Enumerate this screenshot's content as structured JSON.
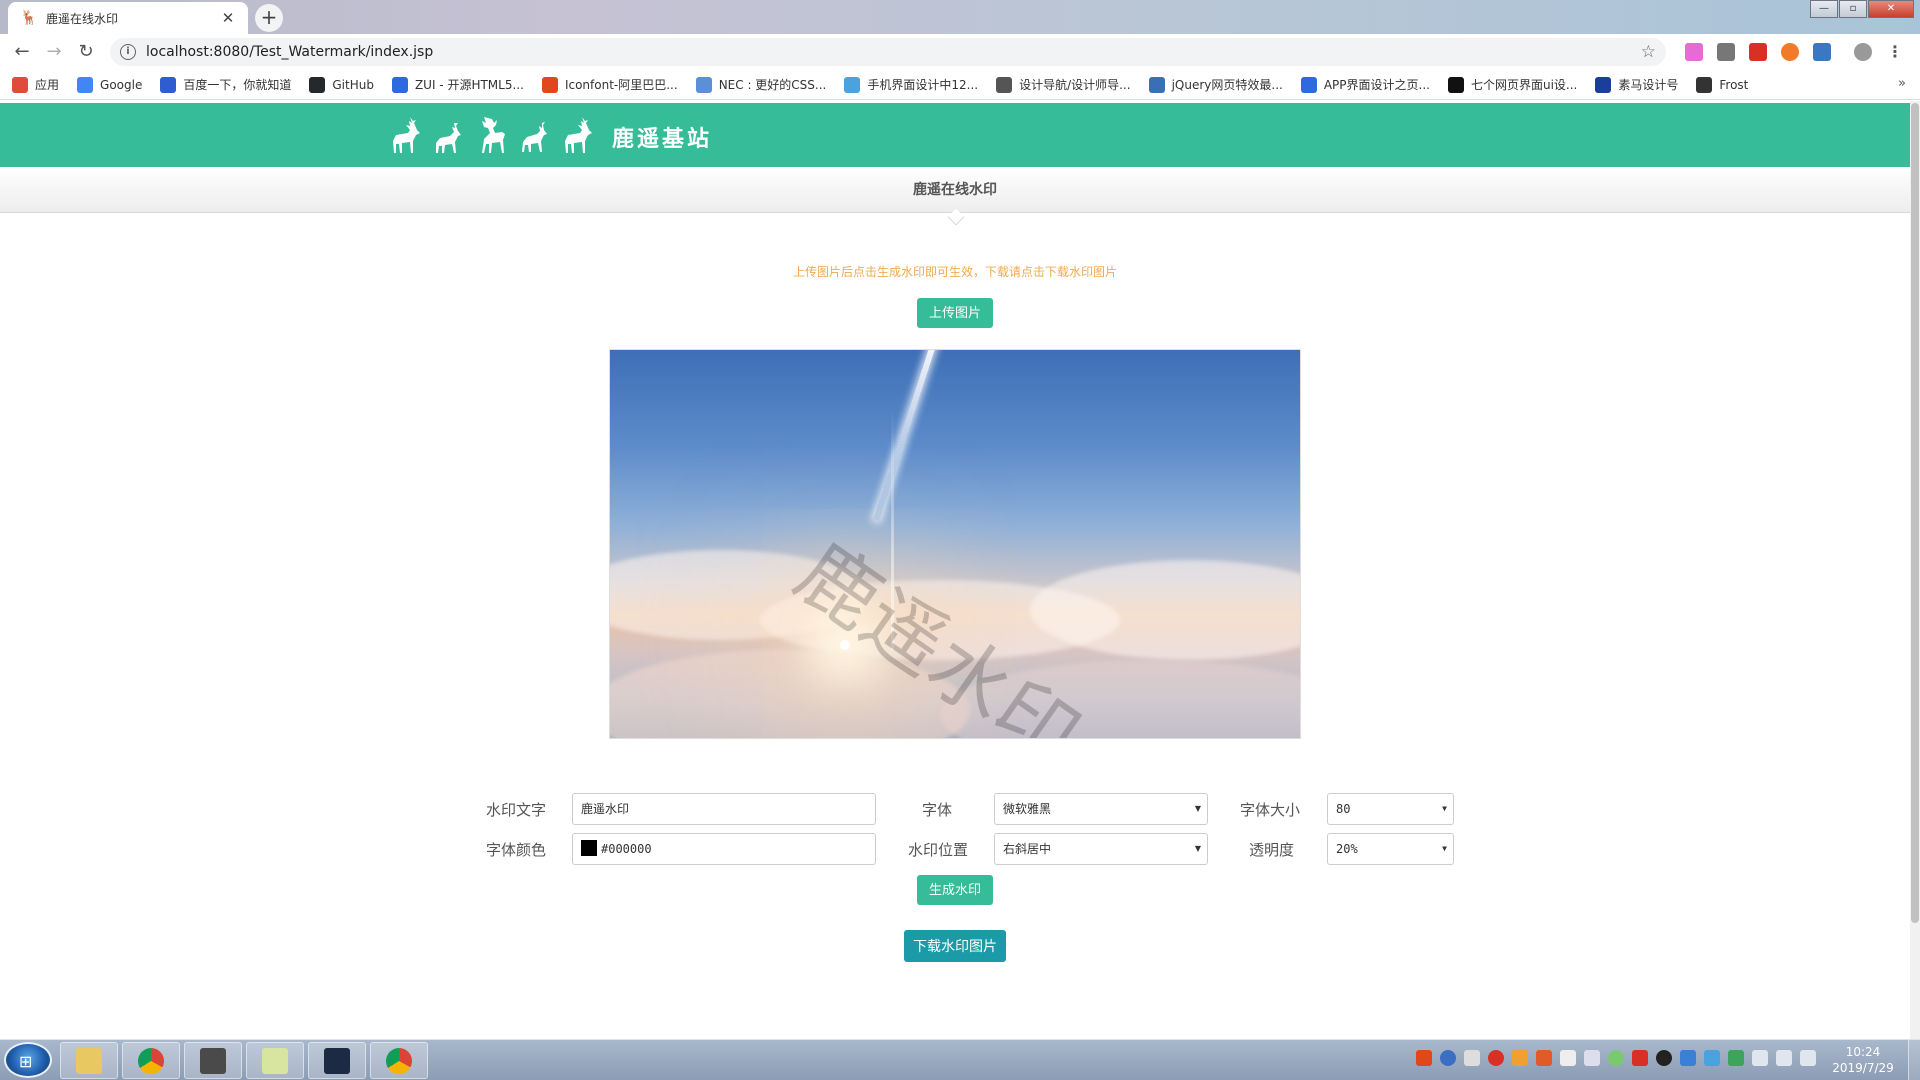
{
  "browser": {
    "tab_title": "鹿遥在线水印",
    "new_tab": "+",
    "url": "localhost:8080/Test_Watermark/index.jsp",
    "bookmarks": [
      {
        "label": "应用",
        "icon": "apps-icon",
        "color": "#e04b3c"
      },
      {
        "label": "Google",
        "icon": "google-icon",
        "color": "#4285f4"
      },
      {
        "label": "百度一下，你就知道",
        "icon": "baidu-icon",
        "color": "#2f5cd1"
      },
      {
        "label": "GitHub",
        "icon": "github-icon",
        "color": "#24292e"
      },
      {
        "label": "ZUI - 开源HTML5...",
        "icon": "zui-icon",
        "color": "#2d6ae0"
      },
      {
        "label": "Iconfont-阿里巴巴...",
        "icon": "iconfont-icon",
        "color": "#e0481c"
      },
      {
        "label": "NEC : 更好的CSS...",
        "icon": "nec-icon",
        "color": "#5b8fd6"
      },
      {
        "label": "手机界面设计中12...",
        "icon": "plane-icon",
        "color": "#4aa3df"
      },
      {
        "label": "设计导航/设计师导...",
        "icon": "design-icon",
        "color": "#555555"
      },
      {
        "label": "jQuery网页特效最...",
        "icon": "jquery-icon",
        "color": "#3a6fb8"
      },
      {
        "label": "APP界面设计之页...",
        "icon": "app-icon",
        "color": "#2d6ae0"
      },
      {
        "label": "七个网页界面ui设...",
        "icon": "s-icon",
        "color": "#111111"
      },
      {
        "label": "素马设计号",
        "icon": "suma-icon",
        "color": "#1a3f9a"
      },
      {
        "label": "Frost",
        "icon": "frost-icon",
        "color": "#333333"
      }
    ],
    "bookmarks_more": "»"
  },
  "site": {
    "logo_text": "鹿遥基站",
    "subnav_title": "鹿遥在线水印",
    "hint": "上传图片后点击生成水印即可生效，下载请点击下载水印图片",
    "upload_button": "上传图片",
    "watermark_preview": "鹿遥水印",
    "form": {
      "text_label": "水印文字",
      "text_value": "鹿遥水印",
      "font_label": "字体",
      "font_value": "微软雅黑",
      "size_label": "字体大小",
      "size_value": "80",
      "color_label": "字体颜色",
      "color_value": "#000000",
      "position_label": "水印位置",
      "position_value": "右斜居中",
      "opacity_label": "透明度",
      "opacity_value": "20%"
    },
    "generate_button": "生成水印",
    "download_button": "下载水印图片"
  },
  "taskbar": {
    "time": "10:24",
    "date": "2019/7/29"
  },
  "colors": {
    "brand_green": "#36bc98",
    "download_teal": "#1b9aa8",
    "hint_orange": "#f0a94f"
  }
}
